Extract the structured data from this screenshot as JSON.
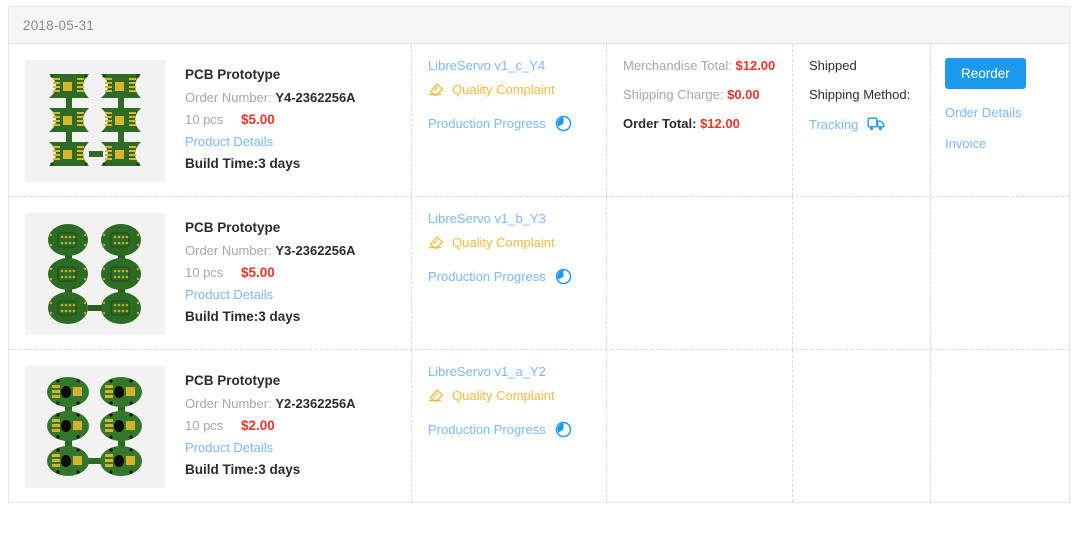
{
  "card": {
    "order_date": "2018-05-31"
  },
  "labels": {
    "order_number": "Order Number:",
    "product_details": "Product Details",
    "quality_complaint": "Quality Complaint",
    "production_progress": "Production Progress",
    "merchandise_total": "Merchandise Total:",
    "shipping_charge": "Shipping Charge:",
    "order_total": "Order Total:",
    "shipping_method": "Shipping Method:",
    "tracking": "Tracking",
    "reorder": "Reorder",
    "order_details": "Order Details",
    "invoice": "Invoice"
  },
  "colors": {
    "accent_blue": "#1b9aee",
    "link_blue": "#7cb8f7",
    "price_red": "#e8342a",
    "warn_orange": "#f4b942",
    "header_bg": "#f5f5f5",
    "border": "#e4e4e4"
  },
  "rows": [
    {
      "product_name": "PCB Prototype",
      "order_number": "Y4-2362256A",
      "quantity": "10 pcs",
      "unit_price": "$5.00",
      "build_time": "Build Time:3 days",
      "project_name": "LibreServo v1_c_Y4",
      "merchandise_total": "$12.00",
      "shipping_charge": "$0.00",
      "order_total": "$12.00",
      "status": "Shipped",
      "shipping_method_value": "",
      "has_summary": true
    },
    {
      "product_name": "PCB Prototype",
      "order_number": "Y3-2362256A",
      "quantity": "10 pcs",
      "unit_price": "$5.00",
      "build_time": "Build Time:3 days",
      "project_name": "LibreServo v1_b_Y3",
      "has_summary": false
    },
    {
      "product_name": "PCB Prototype",
      "order_number": "Y2-2362256A",
      "quantity": "10 pcs",
      "unit_price": "$2.00",
      "build_time": "Build Time:3 days",
      "project_name": "LibreServo v1_a_Y2",
      "has_summary": false
    }
  ]
}
